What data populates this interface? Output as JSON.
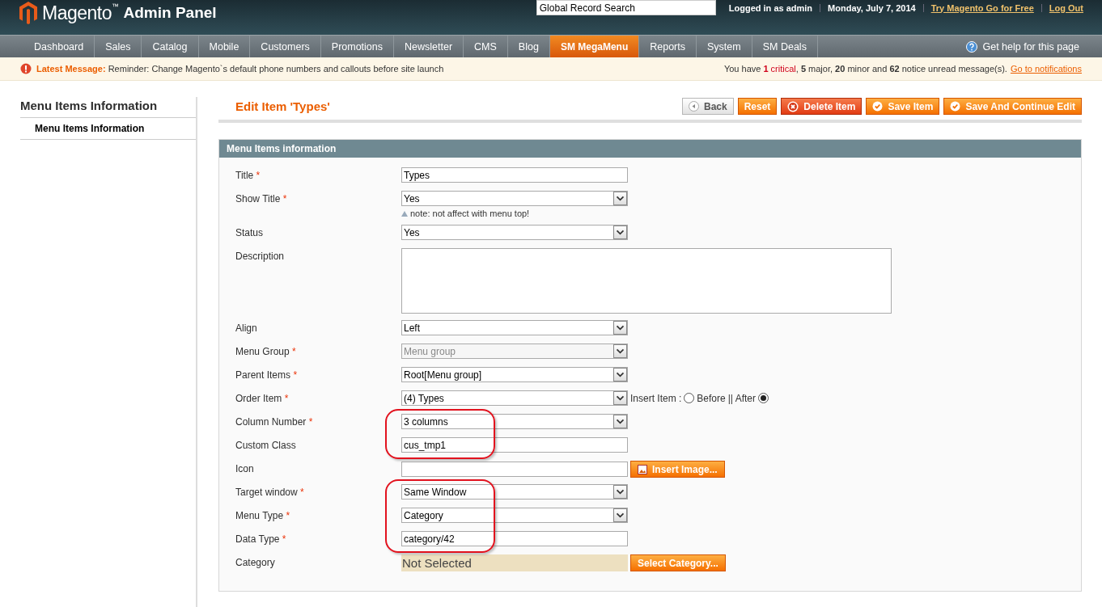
{
  "header": {
    "logo_word": "Magento",
    "logo_tm": "™",
    "logo_suffix": "Admin Panel",
    "search": {
      "value": "Global Record Search"
    },
    "user_text": "Logged in as admin",
    "date": "Monday, July 7, 2014",
    "links": [
      "Try Magento Go for Free",
      "Log Out"
    ]
  },
  "nav": {
    "items": [
      {
        "label": "Dashboard",
        "selected": false
      },
      {
        "label": "Sales",
        "selected": false
      },
      {
        "label": "Catalog",
        "selected": false
      },
      {
        "label": "Mobile",
        "selected": false
      },
      {
        "label": "Customers",
        "selected": false
      },
      {
        "label": "Promotions",
        "selected": false
      },
      {
        "label": "Newsletter",
        "selected": false
      },
      {
        "label": "CMS",
        "selected": false
      },
      {
        "label": "Blog",
        "selected": false
      },
      {
        "label": "SM MegaMenu",
        "selected": true
      },
      {
        "label": "Reports",
        "selected": false
      },
      {
        "label": "System",
        "selected": false
      },
      {
        "label": "SM Deals",
        "selected": false
      }
    ],
    "help": "Get help for this page"
  },
  "message": {
    "label": "Latest Message:",
    "text": "Reminder: Change Magento`s default phone numbers and callouts before site launch",
    "summary": [
      {
        "text": "You have ",
        "kind": "plain"
      },
      {
        "text": "1",
        "kind": "critical-bold"
      },
      {
        "text": " critical",
        "kind": "critical"
      },
      {
        "text": ", ",
        "kind": "plain"
      },
      {
        "text": "5",
        "kind": "bold"
      },
      {
        "text": " major, ",
        "kind": "plain"
      },
      {
        "text": "20",
        "kind": "bold"
      },
      {
        "text": " minor and ",
        "kind": "plain"
      },
      {
        "text": "62",
        "kind": "bold"
      },
      {
        "text": " notice unread message(s).",
        "kind": "plain"
      }
    ],
    "link": "Go to notifications"
  },
  "sidebar": {
    "title": "Menu Items Information",
    "tabs": [
      {
        "label": "Menu Items Information",
        "selected": true
      }
    ]
  },
  "page": {
    "title": "Edit Item 'Types'",
    "buttons": [
      {
        "label": "Back",
        "kind": "back"
      },
      {
        "label": "Reset",
        "kind": "plain"
      },
      {
        "label": "Delete Item",
        "kind": "delete"
      },
      {
        "label": "Save Item",
        "kind": "save"
      },
      {
        "label": "Save And Continue Edit",
        "kind": "save"
      }
    ]
  },
  "section": {
    "title": "Menu Items information",
    "fields": [
      {
        "label": "Title",
        "mark": "*",
        "kind": "text",
        "value": "Types",
        "circled": false
      },
      {
        "label": "Show Title",
        "mark": "*",
        "kind": "select",
        "value": "Yes",
        "note": "note: not affect with menu top!",
        "circled": false
      },
      {
        "label": "Status",
        "kind": "select",
        "value": "Yes",
        "circled": false
      },
      {
        "label": "Description",
        "kind": "textarea",
        "circled": false
      },
      {
        "label": "Align",
        "kind": "select",
        "value": "Left",
        "circled": false
      },
      {
        "label": "Menu Group",
        "mark": "*",
        "kind": "select",
        "value": "Menu group",
        "disabled": true,
        "circled": false
      },
      {
        "label": "Parent Items",
        "mark": "*",
        "kind": "select",
        "value": "Root[Menu group]",
        "circled": false
      },
      {
        "label": "Order Item",
        "mark": "*",
        "kind": "order",
        "value": "(4) Types",
        "insert_label": "Insert Item :",
        "options": [
          {
            "label": "Before",
            "selected": false
          },
          {
            "label": "|| After",
            "selected": true
          }
        ],
        "circled": false
      },
      {
        "label": "Column Number",
        "mark": "*",
        "kind": "select",
        "value": "3 columns",
        "circled": true
      },
      {
        "label": "Custom Class",
        "kind": "text",
        "value": "cus_tmp1",
        "circled": true
      },
      {
        "label": "Icon",
        "kind": "image",
        "button": "Insert Image...",
        "circled": false
      },
      {
        "label": "Target window",
        "mark": "*",
        "kind": "select",
        "value": "Same Window",
        "circled": true
      },
      {
        "label": "Menu Type",
        "mark": "*",
        "kind": "select",
        "value": "Category",
        "circled": true
      },
      {
        "label": "Data Type",
        "mark": "*",
        "kind": "text",
        "value": "category/42",
        "circled": true
      },
      {
        "label": "Category",
        "kind": "category",
        "value": "Not Selected",
        "button": "Select Category...",
        "circled": false
      }
    ]
  }
}
